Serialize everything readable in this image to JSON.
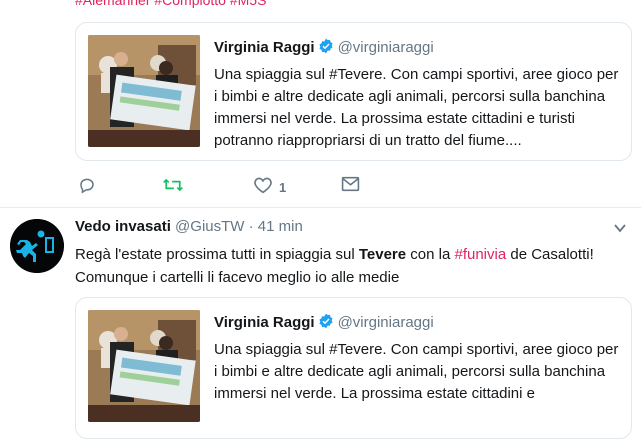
{
  "top_tweet": {
    "hashtags_sliver": "#Aiemanner #Complotto #M5S",
    "quoted": {
      "name": "Virginia Raggi",
      "handle": "@virginiaraggi",
      "text": "Una spiaggia sul #Tevere. Con campi sportivi, aree gioco per i bimbi e altre dedicate agli animali, percorsi sulla banchina immersi nel verde. La prossima estate cittadini e turisti potranno riappropriarsi di un tratto del fiume...."
    },
    "actions": {
      "reply_icon": "reply-icon",
      "retweet_icon": "retweet-icon",
      "like_icon": "heart-icon",
      "like_count": "1",
      "message_icon": "envelope-icon"
    }
  },
  "second_tweet": {
    "name": "Vedo invasati",
    "handle": "@GiusTW",
    "separator": "·",
    "time": "41 min",
    "text_part1": "Regà l'estate prossima tutti in spiaggia sul ",
    "text_bold": "Tevere",
    "text_part2": " con la ",
    "text_hashtag": "#funivia",
    "text_part3": " de Casalotti! Comunque i cartelli li facevo meglio io alle medie",
    "quoted": {
      "name": "Virginia Raggi",
      "handle": "@virginiaraggi",
      "text": "Una spiaggia sul #Tevere. Con campi sportivi, aree gioco per i bimbi e altre dedicate agli animali, percorsi sulla banchina immersi nel verde. La prossima estate cittadini e"
    }
  },
  "colors": {
    "link": "#1da1f2",
    "hashtag": "#e0245e",
    "retweet_green": "#17bf63",
    "muted": "#657786"
  }
}
